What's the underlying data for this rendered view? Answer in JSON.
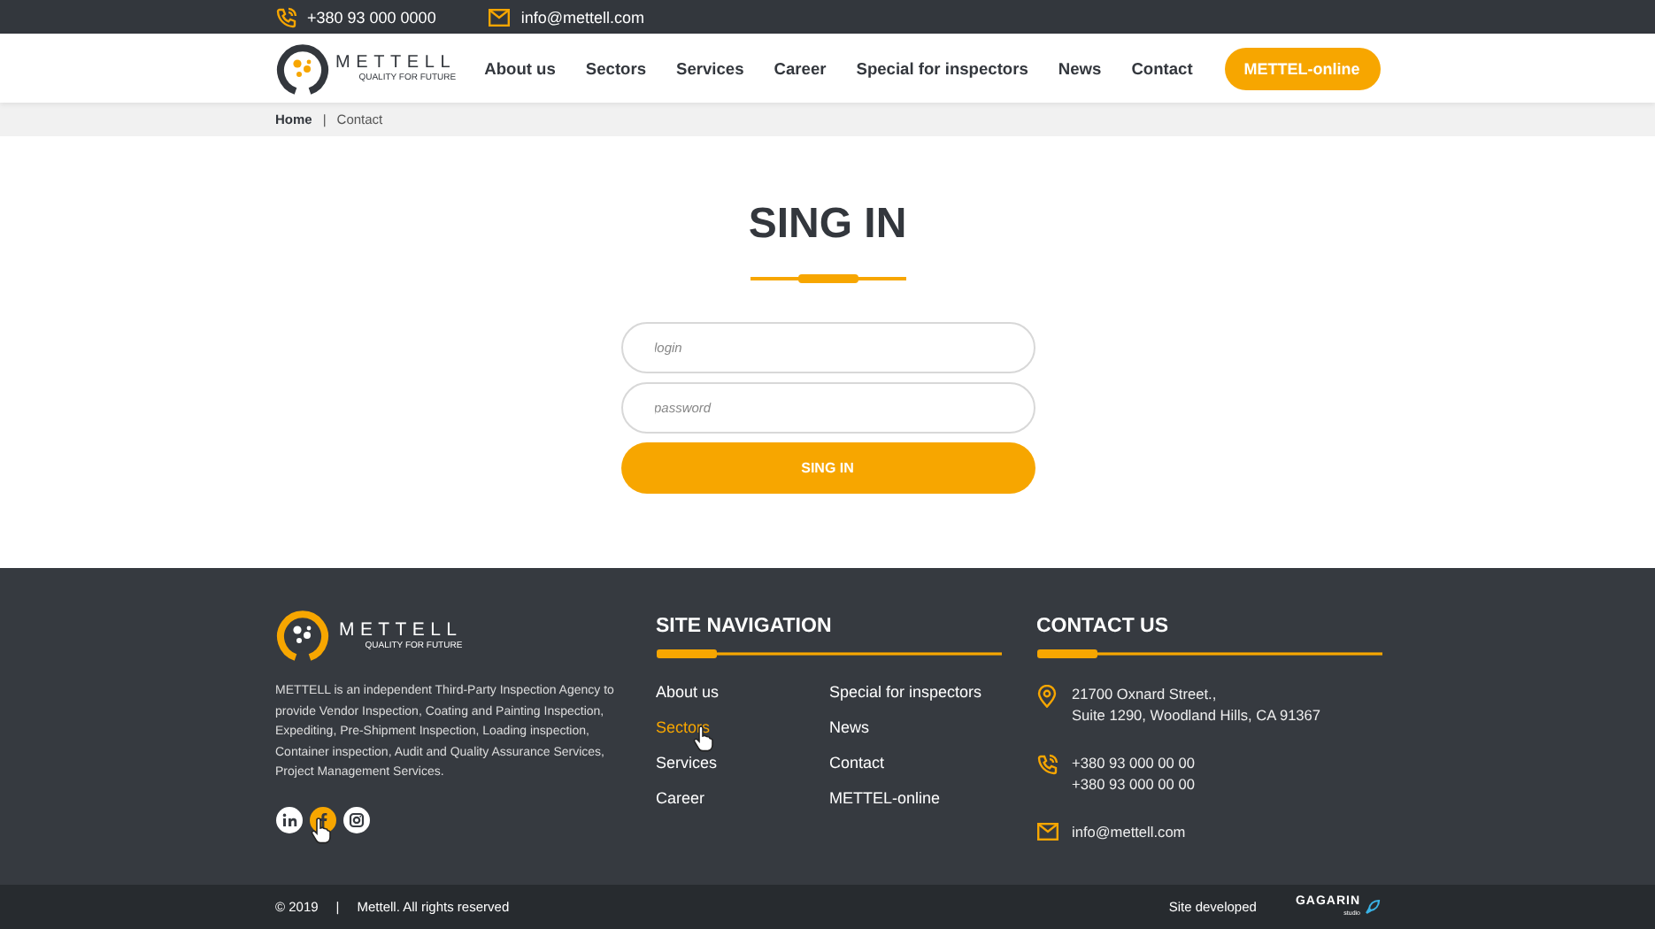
{
  "top_bar": {
    "phone": "+380 93 000 0000",
    "email": "info@mettell.com"
  },
  "header": {
    "logo": {
      "name": "METTELL",
      "tagline": "QUALITY FOR FUTURE"
    },
    "nav": [
      "About us",
      "Sectors",
      "Services",
      "Career",
      "Special for inspectors",
      "News",
      "Contact"
    ],
    "cta": "METTEL-online"
  },
  "breadcrumb": {
    "items": [
      "Home",
      "Contact"
    ],
    "separator": "|"
  },
  "signin": {
    "title": "SING IN",
    "fields": [
      {
        "placeholder": "login"
      },
      {
        "placeholder": "password"
      }
    ],
    "button": "SING IN"
  },
  "footer": {
    "logo": {
      "name": "METTELL",
      "tagline": "QUALITY FOR FUTURE"
    },
    "about": "METTELL is an independent Third-Party Inspection Agency to provide Vendor Inspection, Coating and Painting Inspection, Expediting, Pre-Shipment Inspection, Loading inspection, Container inspection, Audit and Quality Assurance Services, Project Management Services.",
    "social": [
      {
        "kind": "linkedin",
        "highlighted": false
      },
      {
        "kind": "facebook",
        "highlighted": true
      },
      {
        "kind": "instagram",
        "highlighted": false
      }
    ],
    "nav_title": "SITE NAVIGATION",
    "nav": [
      {
        "label": "About us",
        "highlighted": false
      },
      {
        "label": "Sectors",
        "highlighted": true
      },
      {
        "label": "Services",
        "highlighted": false
      },
      {
        "label": "Career",
        "highlighted": false
      },
      {
        "label": "Special for inspectors",
        "highlighted": false
      },
      {
        "label": "News",
        "highlighted": false
      },
      {
        "label": "Contact",
        "highlighted": false
      },
      {
        "label": "METTEL-online",
        "highlighted": false
      }
    ],
    "contact_title": "CONTACT US",
    "contacts": [
      {
        "kind": "address",
        "lines": [
          "21700 Oxnard Street.,",
          "Suite 1290, Woodland Hills, CA 91367"
        ]
      },
      {
        "kind": "phone",
        "lines": [
          "+380 93 000 00 00",
          "+380 93 000 00 00"
        ]
      },
      {
        "kind": "email",
        "lines": [
          "info@mettell.com"
        ]
      }
    ]
  },
  "bottom_bar": {
    "copyright": "© 2019",
    "separator": "|",
    "rights": "Mettell. All rights reserved",
    "developed": "Site developed",
    "studio": "GAGARIN",
    "studio_sub": "studio"
  }
}
